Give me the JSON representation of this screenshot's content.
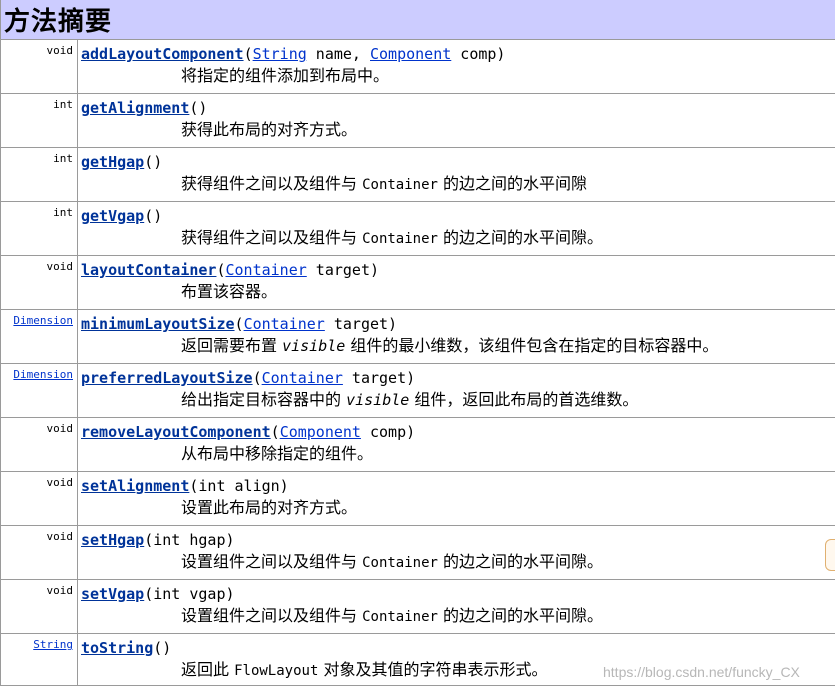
{
  "header": {
    "title": "方法摘要"
  },
  "rows": [
    {
      "type": "void",
      "type_link": false,
      "name": "addLayoutComponent",
      "params": [
        {
          "text": "(",
          "link": false
        },
        {
          "text": "String",
          "link": true
        },
        {
          "text": " name, ",
          "link": false
        },
        {
          "text": "Component",
          "link": true
        },
        {
          "text": " comp)",
          "link": false
        }
      ],
      "desc": [
        {
          "text": "将指定的组件添加到布局中。",
          "style": "normal"
        }
      ]
    },
    {
      "type": "int",
      "type_link": false,
      "name": "getAlignment",
      "params": [
        {
          "text": "()",
          "link": false
        }
      ],
      "desc": [
        {
          "text": "获得此布局的对齐方式。",
          "style": "normal"
        }
      ]
    },
    {
      "type": "int",
      "type_link": false,
      "name": "getHgap",
      "params": [
        {
          "text": "()",
          "link": false
        }
      ],
      "desc": [
        {
          "text": "获得组件之间以及组件与 ",
          "style": "normal"
        },
        {
          "text": "Container",
          "style": "mono"
        },
        {
          "text": " 的边之间的水平间隙",
          "style": "normal"
        }
      ]
    },
    {
      "type": "int",
      "type_link": false,
      "name": "getVgap",
      "params": [
        {
          "text": "()",
          "link": false
        }
      ],
      "desc": [
        {
          "text": "获得组件之间以及组件与 ",
          "style": "normal"
        },
        {
          "text": "Container",
          "style": "mono"
        },
        {
          "text": " 的边之间的水平间隙。",
          "style": "normal"
        }
      ]
    },
    {
      "type": "void",
      "type_link": false,
      "name": "layoutContainer",
      "params": [
        {
          "text": "(",
          "link": false
        },
        {
          "text": "Container",
          "link": true
        },
        {
          "text": " target)",
          "link": false
        }
      ],
      "desc": [
        {
          "text": "布置该容器。",
          "style": "normal"
        }
      ]
    },
    {
      "type": "Dimension",
      "type_link": true,
      "name": "minimumLayoutSize",
      "params": [
        {
          "text": "(",
          "link": false
        },
        {
          "text": "Container",
          "link": true
        },
        {
          "text": " target)",
          "link": false
        }
      ],
      "desc": [
        {
          "text": "返回需要布置 ",
          "style": "normal"
        },
        {
          "text": "visible",
          "style": "ital"
        },
        {
          "text": " 组件的最小维数，该组件包含在指定的目标容器中。",
          "style": "normal"
        }
      ]
    },
    {
      "type": "Dimension",
      "type_link": true,
      "name": "preferredLayoutSize",
      "params": [
        {
          "text": "(",
          "link": false
        },
        {
          "text": "Container",
          "link": true
        },
        {
          "text": " target)",
          "link": false
        }
      ],
      "desc": [
        {
          "text": "给出指定目标容器中的 ",
          "style": "normal"
        },
        {
          "text": "visible",
          "style": "ital"
        },
        {
          "text": " 组件，返回此布局的首选维数。",
          "style": "normal"
        }
      ]
    },
    {
      "type": "void",
      "type_link": false,
      "name": "removeLayoutComponent",
      "params": [
        {
          "text": "(",
          "link": false
        },
        {
          "text": "Component",
          "link": true
        },
        {
          "text": " comp)",
          "link": false
        }
      ],
      "desc": [
        {
          "text": "从布局中移除指定的组件。",
          "style": "normal"
        }
      ]
    },
    {
      "type": "void",
      "type_link": false,
      "name": "setAlignment",
      "params": [
        {
          "text": "(int align)",
          "link": false
        }
      ],
      "desc": [
        {
          "text": "设置此布局的对齐方式。",
          "style": "normal"
        }
      ]
    },
    {
      "type": "void",
      "type_link": false,
      "name": "setHgap",
      "params": [
        {
          "text": "(int hgap)",
          "link": false
        }
      ],
      "desc": [
        {
          "text": "设置组件之间以及组件与 ",
          "style": "normal"
        },
        {
          "text": "Container",
          "style": "mono"
        },
        {
          "text": " 的边之间的水平间隙。",
          "style": "normal"
        }
      ]
    },
    {
      "type": "void",
      "type_link": false,
      "name": "setVgap",
      "params": [
        {
          "text": "(int vgap)",
          "link": false
        }
      ],
      "desc": [
        {
          "text": "设置组件之间以及组件与 ",
          "style": "normal"
        },
        {
          "text": "Container",
          "style": "mono"
        },
        {
          "text": " 的边之间的水平间隙。",
          "style": "normal"
        }
      ]
    },
    {
      "type": "String",
      "type_link": true,
      "name": "toString",
      "params": [
        {
          "text": "()",
          "link": false
        }
      ],
      "desc": [
        {
          "text": "返回此 ",
          "style": "normal"
        },
        {
          "text": "FlowLayout",
          "style": "mono"
        },
        {
          "text": " 对象及其值的字符串表示形式。",
          "style": "normal"
        }
      ]
    }
  ],
  "watermark": "https://blog.csdn.net/funcky_CX"
}
